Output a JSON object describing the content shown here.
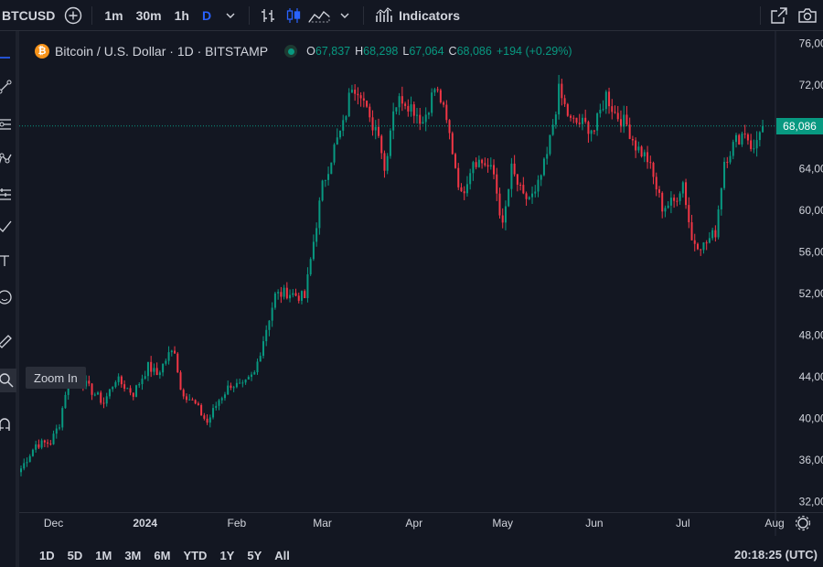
{
  "toolbar": {
    "symbol": "BTCUSD",
    "intervals": [
      "1m",
      "30m",
      "1h",
      "D"
    ],
    "active_interval": "D",
    "indicators_label": "Indicators"
  },
  "legend": {
    "title": "Bitcoin / U.S. Dollar · 1D · BITSTAMP",
    "o_key": "O",
    "o_val": "67,837",
    "h_key": "H",
    "h_val": "68,298",
    "l_key": "L",
    "l_val": "67,064",
    "c_key": "C",
    "c_val": "68,086",
    "change": "+194 (+0.29%)"
  },
  "tooltip": "Zoom In",
  "bottom": {
    "ranges": [
      "1D",
      "5D",
      "1M",
      "3M",
      "6M",
      "YTD",
      "1Y",
      "5Y",
      "All"
    ],
    "clock": "20:18:25 (UTC)"
  },
  "colors": {
    "up": "#089981",
    "down": "#f23645",
    "background": "#131722",
    "accent": "#2962ff"
  },
  "chart_data": {
    "type": "candlestick",
    "symbol": "BTCUSD",
    "timeframe": "1D",
    "exchange": "BITSTAMP",
    "current_price": "68,086",
    "y_ticks": [
      "76,000",
      "72,000",
      "68,000",
      "64,000",
      "60,000",
      "56,000",
      "52,000",
      "48,000",
      "44,000",
      "40,000",
      "36,000",
      "32,000"
    ],
    "ylim": [
      31000,
      77200
    ],
    "x_ticks": [
      "Dec",
      "2024",
      "Feb",
      "Mar",
      "Apr",
      "May",
      "Jun",
      "Jul",
      "Aug"
    ],
    "x_tick_dates": [
      "2023-12-01",
      "2024-01-01",
      "2024-02-01",
      "2024-03-01",
      "2024-04-01",
      "2024-05-01",
      "2024-06-01",
      "2024-07-01",
      "2024-08-01"
    ],
    "date_range": [
      "2023-11-20",
      "2024-08-01"
    ],
    "closes": [
      [
        "2023-11-20",
        35200
      ],
      [
        "2023-11-25",
        37500
      ],
      [
        "2023-11-30",
        37700
      ],
      [
        "2023-12-03",
        39500
      ],
      [
        "2023-12-06",
        44000
      ],
      [
        "2023-12-10",
        43800
      ],
      [
        "2023-12-13",
        42900
      ],
      [
        "2023-12-18",
        41500
      ],
      [
        "2023-12-22",
        43800
      ],
      [
        "2023-12-28",
        42400
      ],
      [
        "2024-01-02",
        45000
      ],
      [
        "2024-01-05",
        44200
      ],
      [
        "2024-01-09",
        46100
      ],
      [
        "2024-01-11",
        46600
      ],
      [
        "2024-01-13",
        42800
      ],
      [
        "2024-01-18",
        41300
      ],
      [
        "2024-01-22",
        39600
      ],
      [
        "2024-01-26",
        41800
      ],
      [
        "2024-01-30",
        43300
      ],
      [
        "2024-02-03",
        43000
      ],
      [
        "2024-02-07",
        44300
      ],
      [
        "2024-02-10",
        47600
      ],
      [
        "2024-02-14",
        51800
      ],
      [
        "2024-02-18",
        52100
      ],
      [
        "2024-02-24",
        51600
      ],
      [
        "2024-02-27",
        57000
      ],
      [
        "2024-03-01",
        62300
      ],
      [
        "2024-03-05",
        66000
      ],
      [
        "2024-03-08",
        68100
      ],
      [
        "2024-03-11",
        72100
      ],
      [
        "2024-03-14",
        71500
      ],
      [
        "2024-03-17",
        68400
      ],
      [
        "2024-03-20",
        67800
      ],
      [
        "2024-03-22",
        63800
      ],
      [
        "2024-03-25",
        69900
      ],
      [
        "2024-03-28",
        70800
      ],
      [
        "2024-04-01",
        69700
      ],
      [
        "2024-04-04",
        68500
      ],
      [
        "2024-04-08",
        71700
      ],
      [
        "2024-04-10",
        70600
      ],
      [
        "2024-04-13",
        67200
      ],
      [
        "2024-04-17",
        61300
      ],
      [
        "2024-04-21",
        64900
      ],
      [
        "2024-04-25",
        64500
      ],
      [
        "2024-04-28",
        63400
      ],
      [
        "2024-05-01",
        58300
      ],
      [
        "2024-05-04",
        63900
      ],
      [
        "2024-05-08",
        61100
      ],
      [
        "2024-05-12",
        61400
      ],
      [
        "2024-05-16",
        65200
      ],
      [
        "2024-05-20",
        71400
      ],
      [
        "2024-05-24",
        68500
      ],
      [
        "2024-05-28",
        68300
      ],
      [
        "2024-06-01",
        67700
      ],
      [
        "2024-06-05",
        71100
      ],
      [
        "2024-06-08",
        69300
      ],
      [
        "2024-06-12",
        68200
      ],
      [
        "2024-06-15",
        66200
      ],
      [
        "2024-06-19",
        64900
      ],
      [
        "2024-06-24",
        60300
      ],
      [
        "2024-06-28",
        60800
      ],
      [
        "2024-07-01",
        62700
      ],
      [
        "2024-07-04",
        57100
      ],
      [
        "2024-07-08",
        56600
      ],
      [
        "2024-07-12",
        57900
      ],
      [
        "2024-07-15",
        64800
      ],
      [
        "2024-07-19",
        66700
      ],
      [
        "2024-07-22",
        67600
      ],
      [
        "2024-07-25",
        65600
      ],
      [
        "2024-07-27",
        67900
      ],
      [
        "2024-07-28",
        68086
      ]
    ]
  }
}
